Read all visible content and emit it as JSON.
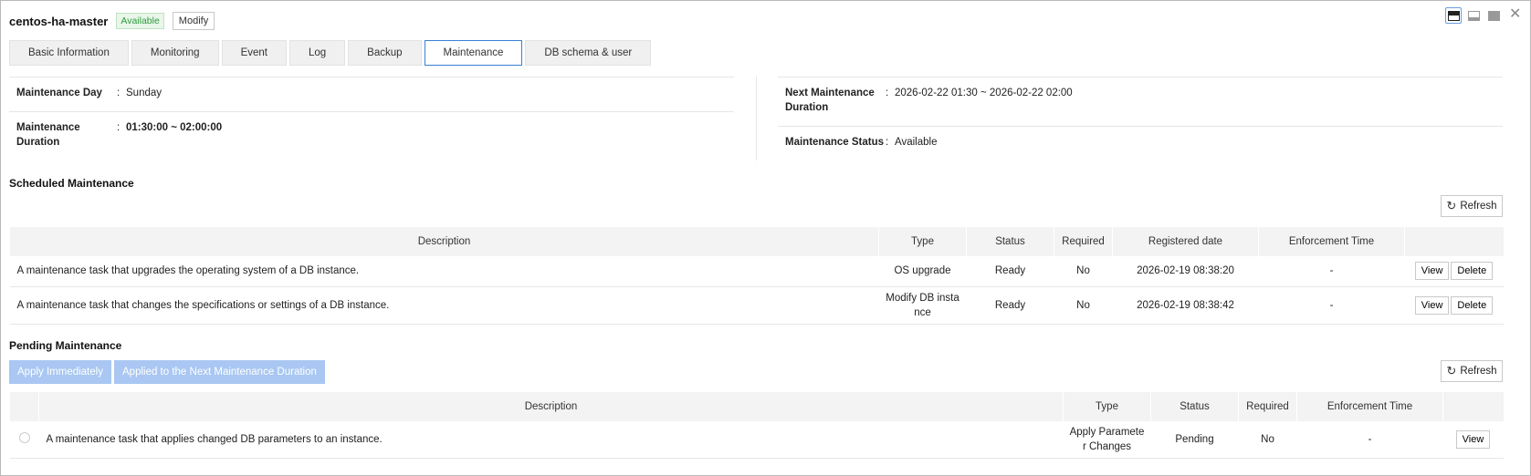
{
  "header": {
    "title": "centos-ha-master",
    "status": "Available",
    "modify_label": "Modify"
  },
  "tabs": [
    "Basic Information",
    "Monitoring",
    "Event",
    "Log",
    "Backup",
    "Maintenance",
    "DB schema & user"
  ],
  "info": {
    "day_label": "Maintenance Day",
    "day_value": "Sunday",
    "duration_label": "Maintenance Duration",
    "duration_value": "01:30:00 ~ 02:00:00",
    "next_label": "Next Maintenance Duration",
    "next_value": "2026-02-22 01:30 ~ 2026-02-22 02:00",
    "status_label": "Maintenance Status",
    "status_value": "Available"
  },
  "scheduled": {
    "title": "Scheduled Maintenance",
    "refresh_label": "Refresh",
    "columns": [
      "Description",
      "Type",
      "Status",
      "Required",
      "Registered date",
      "Enforcement Time",
      ""
    ],
    "rows": [
      {
        "desc": "A maintenance task that upgrades the operating system of a DB instance.",
        "type": "OS upgrade",
        "status": "Ready",
        "required": "No",
        "date": "2026-02-19 08:38:20",
        "enforcement": "-"
      },
      {
        "desc": "A maintenance task that changes the specifications or settings of a DB instance.",
        "type": "Modify DB insta nce",
        "status": "Ready",
        "required": "No",
        "date": "2026-02-19 08:38:42",
        "enforcement": "-"
      }
    ],
    "view_label": "View",
    "delete_label": "Delete"
  },
  "pending": {
    "title": "Pending Maintenance",
    "apply_now_label": "Apply Immediately",
    "apply_next_label": "Applied to the Next Maintenance Duration",
    "refresh_label": "Refresh",
    "columns": [
      "",
      "Description",
      "Type",
      "Status",
      "Required",
      "Enforcement Time",
      ""
    ],
    "rows": [
      {
        "desc": "A maintenance task that applies changed DB parameters to an instance.",
        "type": "Apply Paramete r Changes",
        "status": "Pending",
        "required": "No",
        "enforcement": "-"
      }
    ],
    "view_label": "View"
  },
  "colors": {
    "accent": "#3a7fd5",
    "badge_green": "#2e9b3d",
    "disabled_btn": "#a9c7f2"
  }
}
